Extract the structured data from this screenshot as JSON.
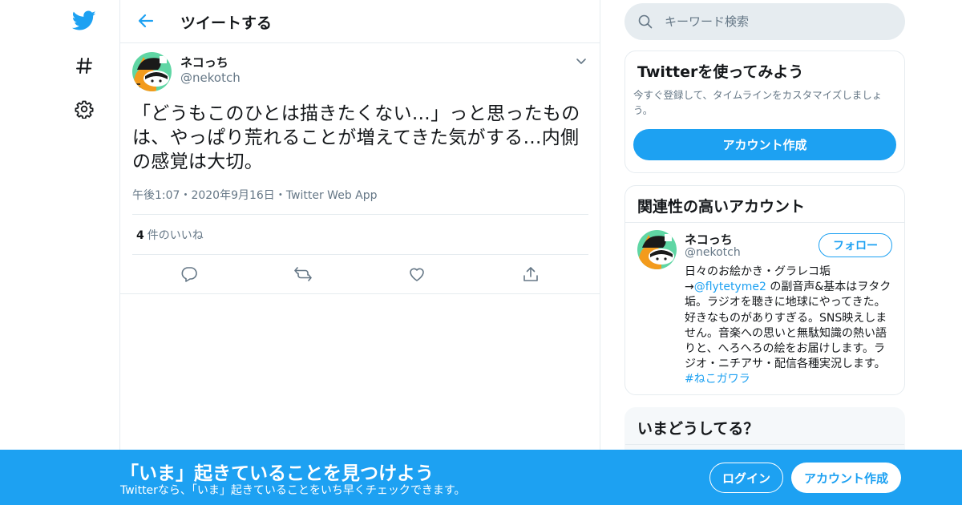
{
  "colors": {
    "accent": "#1da1f2",
    "text": "#14171a",
    "muted": "#657786",
    "border": "#e6ecf0"
  },
  "nav": {
    "icons": [
      "twitter-bird-icon",
      "hashtag-icon",
      "settings-gear-icon"
    ]
  },
  "header": {
    "title": "ツイートする"
  },
  "tweet": {
    "name": "ネコっち",
    "handle": "@nekotch",
    "text": "「どうもこのひとは描きたくない…」っと思ったものは、やっぱり荒れることが増えてきた気がする…内側の感覚は大切。",
    "time": "午後1:07",
    "date": "2020年9月16日",
    "source": "Twitter Web App",
    "sep": "・",
    "likes_count": "4",
    "likes_label": "件のいいね"
  },
  "search": {
    "placeholder": "キーワード検索"
  },
  "signup_card": {
    "title": "Twitterを使ってみよう",
    "desc": "今すぐ登録して、タイムラインをカスタマイズしましょう。",
    "button": "アカウント作成"
  },
  "related": {
    "title": "関連性の高いアカウント",
    "name": "ネコっち",
    "handle": "@nekotch",
    "follow": "フォロー",
    "bio_1": "日々のお絵かき・グラレコ垢→",
    "bio_link": "@flytetyme2",
    "bio_2": " の副音声&基本はヲタク垢。ラジオを聴きに地球にやってきた。好きなものがありすぎる。SNS映えしません。音楽への思いと無駄知識の熱い語りと、へろへろの絵をお届けします。ラジオ・ニチアサ・配信各種実況します。",
    "bio_tag": "#ねこガワラ"
  },
  "trends": {
    "title": "いまどうしてる？"
  },
  "banner": {
    "title": "「いま」起きていることを見つけよう",
    "subtitle": "Twitterなら、「いま」起きていることをいち早くチェックできます。",
    "login": "ログイン",
    "signup": "アカウント作成"
  }
}
